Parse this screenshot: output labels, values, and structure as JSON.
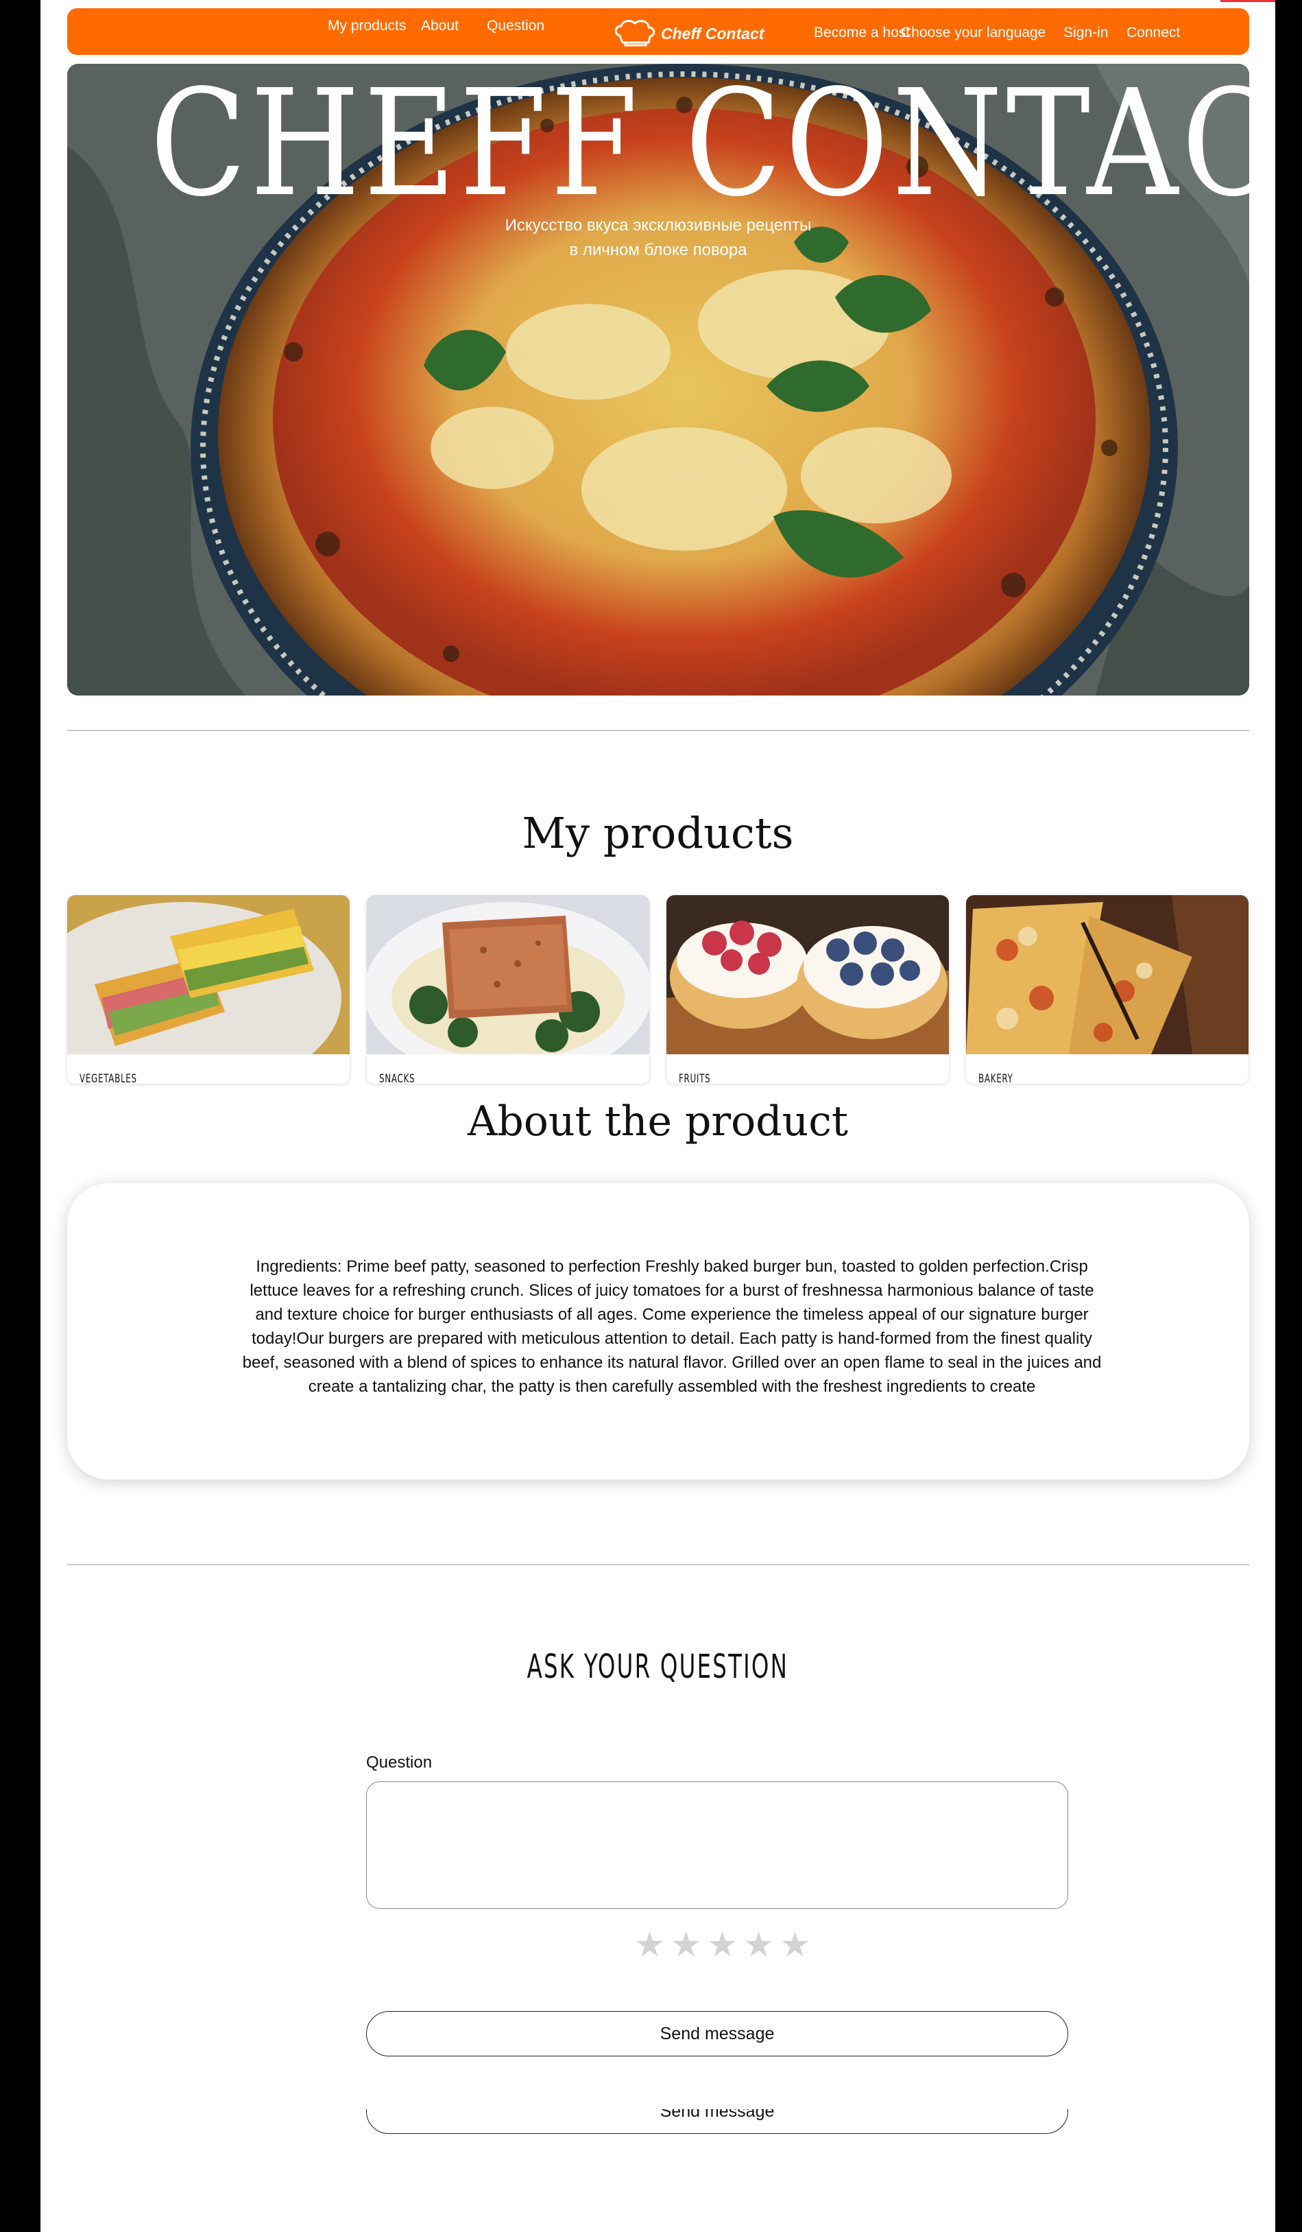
{
  "nav": {
    "links_left": [
      "My products",
      "About",
      "Question"
    ],
    "logo_text": "Cheff Contact",
    "links_right": [
      "Become a host",
      "Choose your language",
      "Sign-in",
      "Connect"
    ],
    "color": "#ff6b00"
  },
  "hero": {
    "title": "CHEFF CONTACT",
    "subtitle_line1": "Искусство вкуса эксклюзивные рецепты",
    "subtitle_line2": "в личном блоке повора",
    "image": "pizza-photo"
  },
  "products": {
    "title": "My products",
    "cards": [
      {
        "label": "VEGETABLES",
        "image": "sandwich-photo"
      },
      {
        "label": "SNACKS",
        "image": "salmon-photo"
      },
      {
        "label": "FRUITS",
        "image": "pastry-photo"
      },
      {
        "label": "BAKERY",
        "image": "pizza-slices-photo"
      }
    ]
  },
  "about": {
    "title": "About the product",
    "text": "Ingredients: Prime beef patty, seasoned to perfection  Freshly baked burger bun, toasted to golden perfection.Crisp lettuce leaves for a refreshing crunch. Slices of juicy tomatoes for a burst of freshnessa harmonious balance of taste and texture choice for burger enthusiasts of all ages. Come experience the timeless appeal of our signature burger today!Our burgers are prepared with meticulous attention to detail. Each patty is hand-formed from the finest quality beef, seasoned with a blend of spices to enhance its natural flavor. Grilled over an open flame to seal in the juices and create a tantalizing char, the patty is then carefully assembled with the freshest ingredients to create"
  },
  "question": {
    "title": "ASK YOUR QUESTION",
    "field_label": "Question",
    "field_value": "",
    "rating": 0,
    "rating_max": 5,
    "send_label": "Send message",
    "send_label_2": "Send message"
  }
}
